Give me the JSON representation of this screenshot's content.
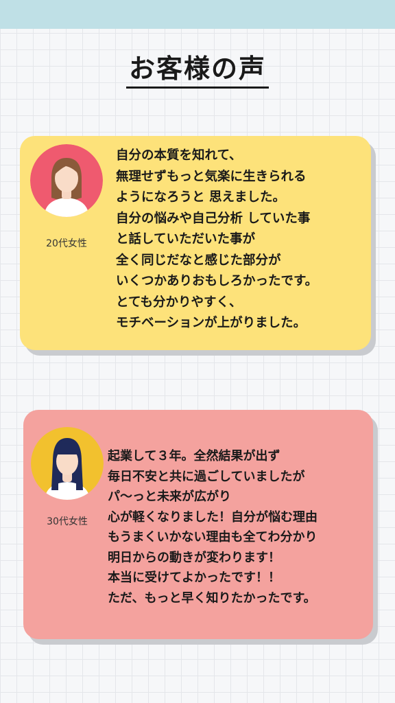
{
  "page": {
    "title": "お客様の声",
    "colors": {
      "top_bar": "#bfe0e6",
      "card1_bg": "#fde27a",
      "card2_bg": "#f4a29e",
      "avatar1_bg": "#ef5a6f",
      "avatar2_bg": "#f2c12e"
    }
  },
  "testimonials": [
    {
      "avatar_icon": "woman-brown-hair-avatar",
      "age_label": "20代女性",
      "lines": [
        "自分の本質を知れて、",
        "無理せずもっと気楽に生きられる",
        "ようになろうと 思えました。",
        "自分の悩みや自己分析 していた事",
        "と話していただいた事が",
        "全く同じだなと感じた部分が",
        "いくつかありおもしろかったです。",
        "とても分かりやすく、",
        "モチベーションが上がりました。"
      ]
    },
    {
      "avatar_icon": "woman-dark-hair-avatar",
      "age_label": "30代女性",
      "lines": [
        "起業して３年。全然結果が出ず",
        "毎日不安と共に過ごしていましたが",
        "パ〜っと未来が広がり",
        "心が軽くなりました！自分が悩む理由",
        "もうまくいかない理由も全てわ分かり",
        "明日からの動きが変わります！",
        "本当に受けてよかったです！！",
        "ただ、もっと早く知りたかったです。"
      ]
    }
  ]
}
